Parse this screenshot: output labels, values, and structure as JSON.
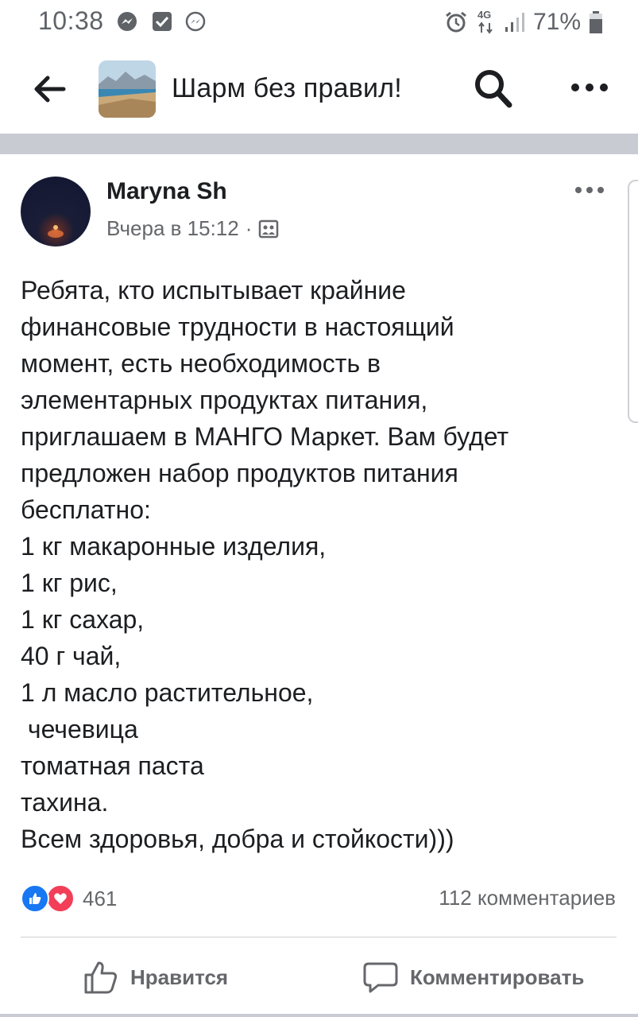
{
  "status_bar": {
    "time": "10:38",
    "left_icons": [
      "messenger-icon",
      "checkbox-icon",
      "messenger-outline-icon"
    ],
    "right_icons": [
      "alarm-icon",
      "network-4g-icon",
      "signal-icon",
      "battery-icon"
    ],
    "network_label": "4G",
    "battery_percent": "71%"
  },
  "header": {
    "title": "Шарм без правил!",
    "icons": [
      "back-arrow-icon",
      "search-icon",
      "more-icon"
    ]
  },
  "post": {
    "author": "Maryna Sh",
    "timestamp": "Вчера в 15:12",
    "separator": "·",
    "privacy_icon": "group-photo-icon",
    "body_lines": [
      "Ребята, кто испытывает крайние",
      "финансовые трудности в настоящий",
      "момент, есть необходимость в",
      "элементарных продуктах питания,",
      "приглашаем в МАНГО Маркет. Вам будет",
      "предложен набор продуктов питания",
      "бесплатно:",
      "1 кг макаронные изделия,",
      "1 кг рис,",
      "1 кг сахар,",
      "40 г чай,",
      "1 л масло растительное,",
      " чечевица",
      "томатная паста",
      "тахина.",
      "Всем здоровья, добра и стойкости)))"
    ],
    "reactions": {
      "types": [
        "like-icon",
        "love-icon"
      ],
      "count": "461",
      "colors": {
        "like": "#1877f2",
        "love": "#f33e58"
      }
    },
    "comments_count": "112 комментариев",
    "actions": {
      "like_label": "Нравится",
      "comment_label": "Комментировать"
    }
  }
}
